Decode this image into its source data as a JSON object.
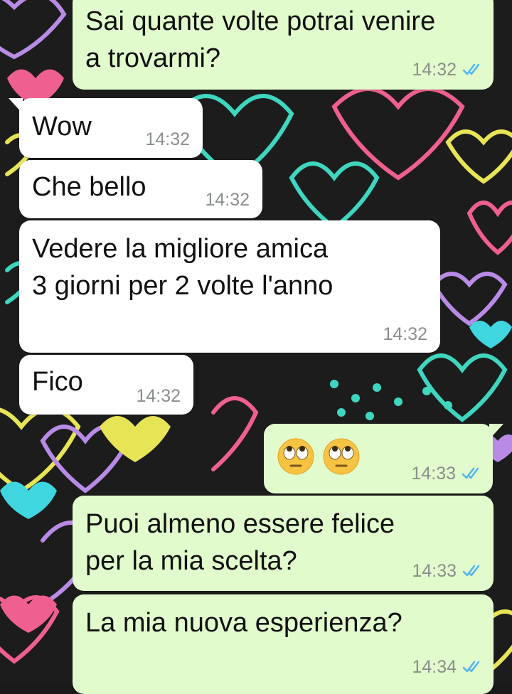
{
  "chat": {
    "messages": [
      {
        "id": "m1",
        "dir": "out",
        "text": "Sai quante volte potrai venire\na trovarmi?",
        "time": "14:32",
        "read": true
      },
      {
        "id": "m2",
        "dir": "in",
        "text": "Wow",
        "time": "14:32"
      },
      {
        "id": "m3",
        "dir": "in",
        "text": "Che bello",
        "time": "14:32"
      },
      {
        "id": "m4",
        "dir": "in",
        "text": "Vedere la migliore amica\n3 giorni per 2 volte l'anno",
        "time": "14:32"
      },
      {
        "id": "m5",
        "dir": "in",
        "text": "Fico",
        "time": "14:32"
      },
      {
        "id": "m6",
        "dir": "out",
        "emoji": [
          "face-with-rolling-eyes",
          "face-with-rolling-eyes"
        ],
        "time": "14:33",
        "read": true
      },
      {
        "id": "m7",
        "dir": "out",
        "text": "Puoi almeno essere felice\nper la mia scelta?",
        "time": "14:33",
        "read": true
      },
      {
        "id": "m8",
        "dir": "out",
        "text": "La mia nuova esperienza?",
        "time": "14:34",
        "read": true
      }
    ]
  },
  "colors": {
    "incoming_bubble": "#ffffff",
    "outgoing_bubble": "#e2fbcd",
    "read_ticks": "#4fb6ec",
    "timestamp": "#8a8f8c",
    "wallpaper": "#1a1a1a"
  }
}
